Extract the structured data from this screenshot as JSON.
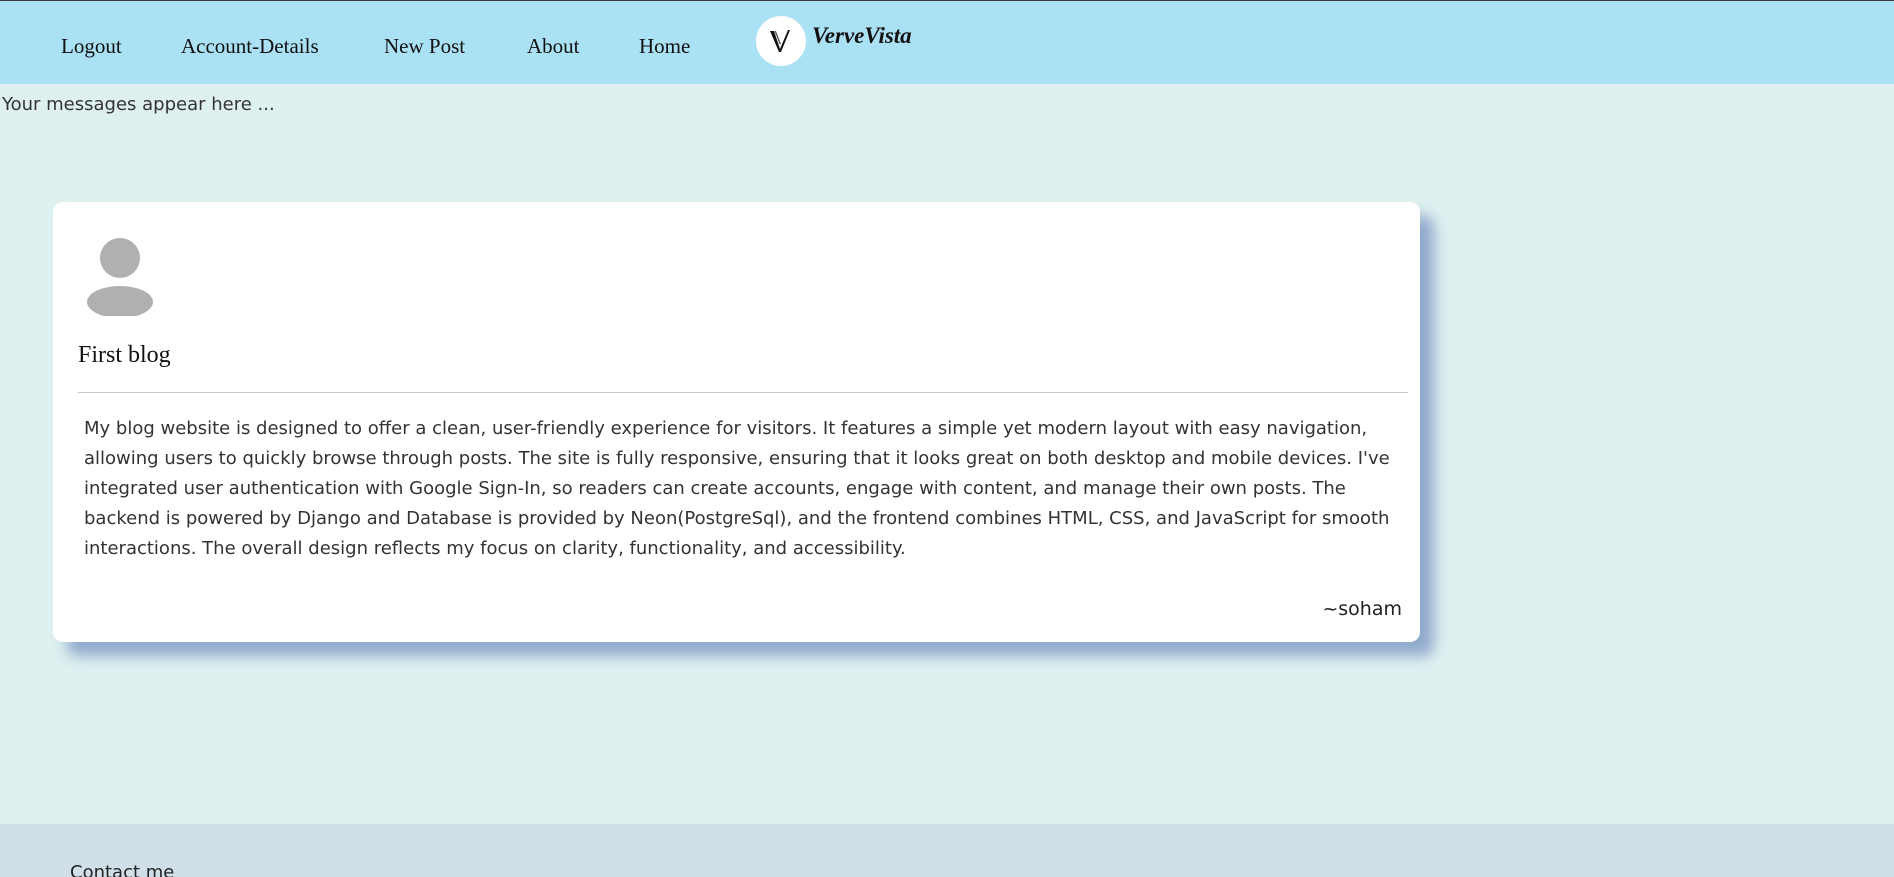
{
  "nav": {
    "items": [
      {
        "label": "Logout"
      },
      {
        "label": "Account-Details"
      },
      {
        "label": "New Post"
      },
      {
        "label": "About"
      },
      {
        "label": "Home"
      }
    ],
    "brand": "VerveVista",
    "logo_letter": "V",
    "logo_icon": "vervevista-logo-icon"
  },
  "messages": {
    "text": "Your messages appear here ..."
  },
  "post": {
    "avatar_icon": "user-avatar-icon",
    "title": "First blog",
    "body": "My blog website is designed to offer a clean, user-friendly experience for visitors. It features a simple yet modern layout with easy navigation, allowing users to quickly browse through posts. The site is fully responsive, ensuring that it looks great on both desktop and mobile devices. I've integrated user authentication with Google Sign-In, so readers can create accounts, engage with content, and manage their own posts. The backend is powered by Django and Database is provided by Neon(PostgreSql), and the frontend combines HTML, CSS, and JavaScript for smooth interactions. The overall design reflects my focus on clarity, functionality, and accessibility.",
    "author": "~soham"
  },
  "footer": {
    "contact_label": "Contact me"
  },
  "colors": {
    "navbar_bg": "#abe1f4",
    "page_bg": "#dff0f0",
    "card_bg": "#ffffff",
    "footer_bg": "#d1e0e8",
    "avatar_grey": "#b0b0b0"
  }
}
